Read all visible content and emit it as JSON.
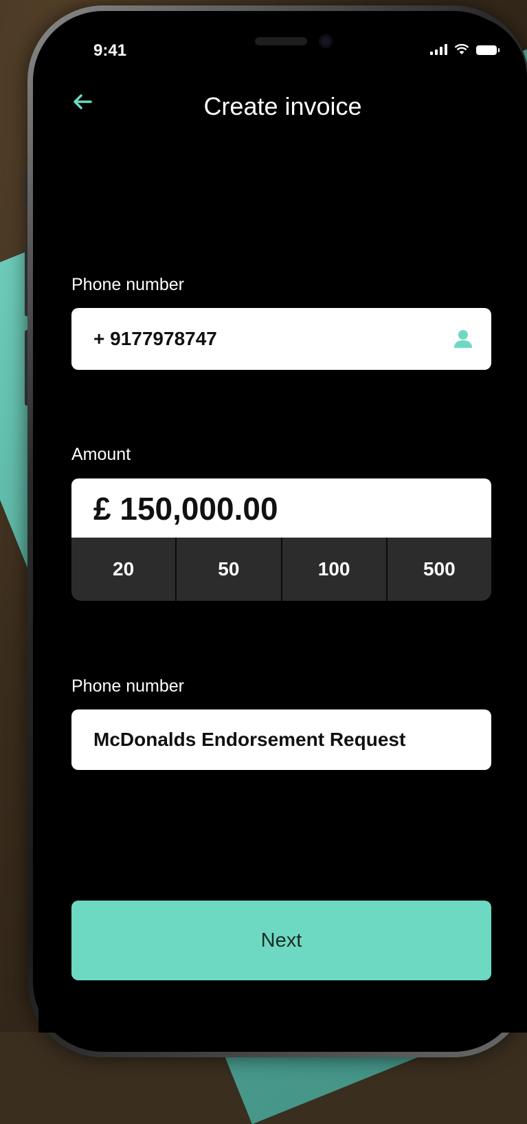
{
  "status_bar": {
    "time": "9:41"
  },
  "header": {
    "title": "Create invoice",
    "back_icon": "arrow-left-icon"
  },
  "phone_field": {
    "label": "Phone number",
    "value": "+ 9177978747",
    "icon": "contact-person-icon"
  },
  "amount_field": {
    "label": "Amount",
    "value": "£ 150,000.00",
    "quick_amounts": [
      "20",
      "50",
      "100",
      "500"
    ]
  },
  "description_field": {
    "label": "Phone number",
    "value": "McDonalds Endorsement Request"
  },
  "next_button": {
    "label": "Next"
  },
  "colors": {
    "accent": "#6ed9c2",
    "screen_bg": "#000000",
    "chip_bg": "#2c2c2c"
  }
}
